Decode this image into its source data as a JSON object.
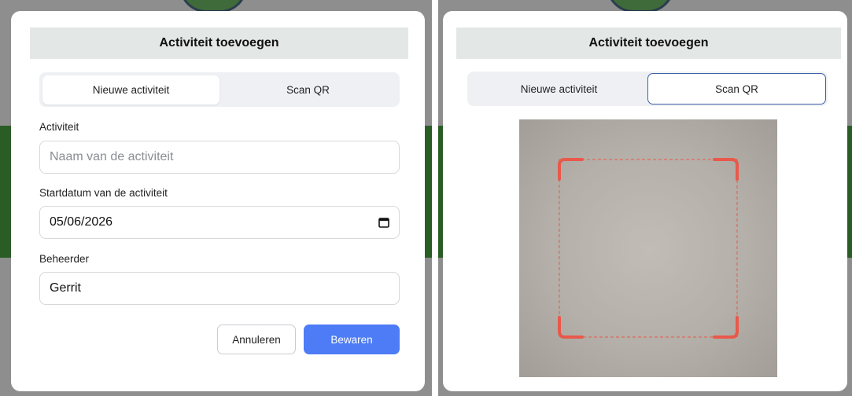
{
  "left": {
    "title": "Activiteit toevoegen",
    "tabs": [
      {
        "label": "Nieuwe activiteit",
        "active": true
      },
      {
        "label": "Scan QR",
        "active": false
      }
    ],
    "form": {
      "activity_label": "Activiteit",
      "activity_placeholder": "Naam van de activiteit",
      "activity_value": "",
      "start_date_label": "Startdatum van de activiteit",
      "start_date_value": "05/06/2026",
      "manager_label": "Beheerder",
      "manager_value": "Gerrit"
    },
    "buttons": {
      "cancel_label": "Annuleren",
      "save_label": "Bewaren"
    }
  },
  "right": {
    "title": "Activiteit toevoegen",
    "tabs": [
      {
        "label": "Nieuwe activiteit",
        "active": false
      },
      {
        "label": "Scan QR",
        "active": true
      }
    ]
  },
  "colors": {
    "accent": "#4d7cf6",
    "title_bar": "#e3e7e6",
    "scan_frame": "#e8594a",
    "backdrop_green": "#2a5d25",
    "active_tab_border": "#3d5fa8"
  },
  "icons": [
    "calendar-icon",
    "qr-scan-frame"
  ]
}
